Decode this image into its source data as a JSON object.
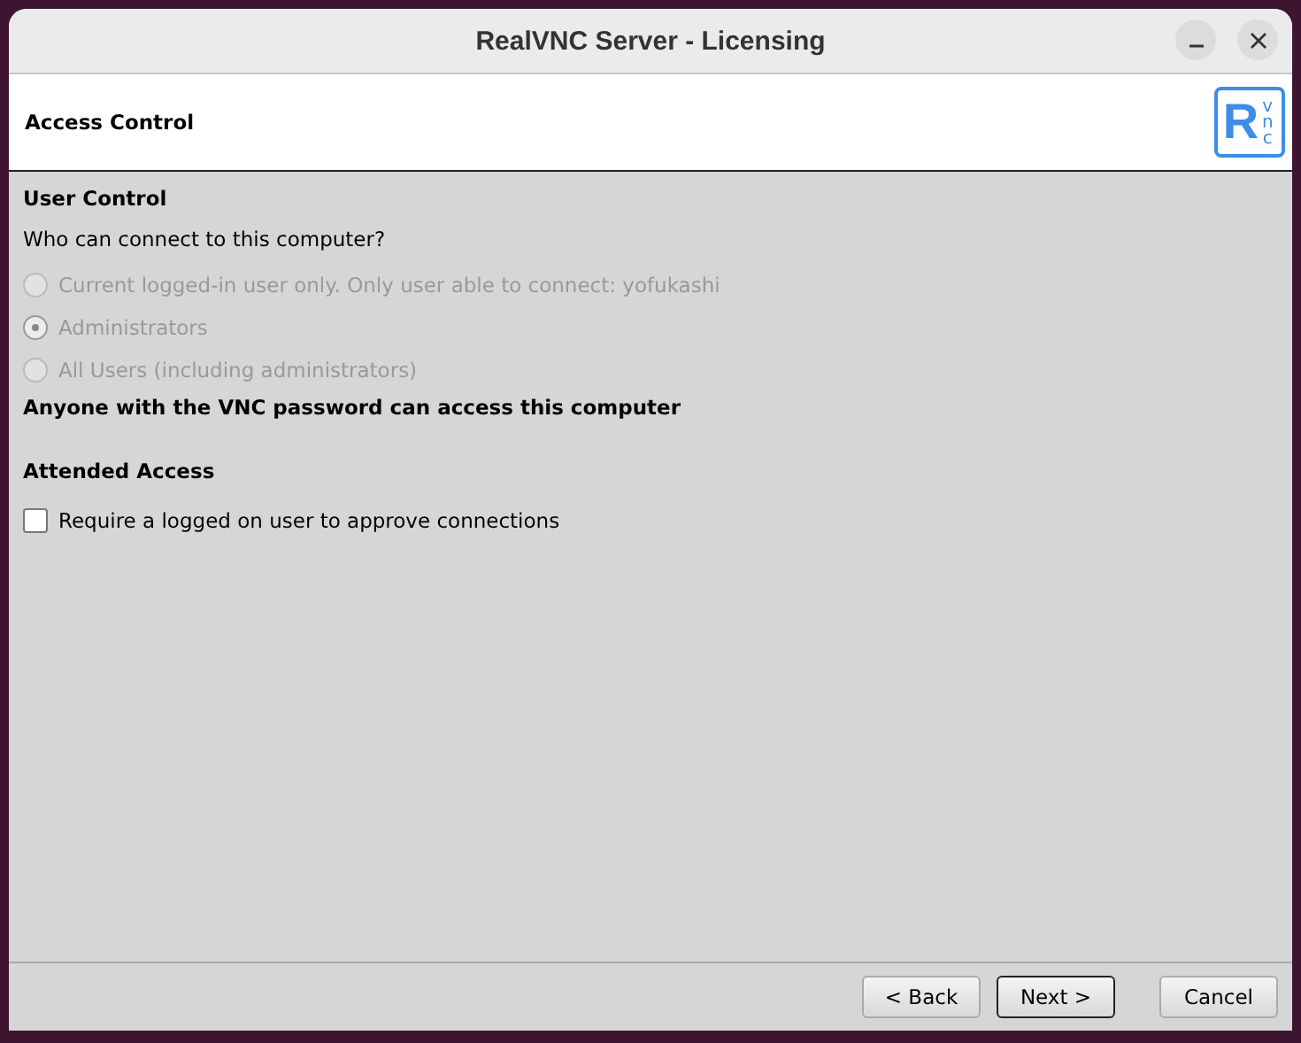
{
  "window": {
    "title": "RealVNC Server - Licensing",
    "controls": [
      {
        "kind": "minimize"
      },
      {
        "kind": "close"
      }
    ]
  },
  "header": {
    "title": "Access Control",
    "logo": {
      "main": "R",
      "side": "vnc"
    }
  },
  "user_control": {
    "heading": "User Control",
    "question": "Who can connect to this computer?",
    "options": [
      {
        "label": "Current logged-in user only. Only user able to connect: yofukashi",
        "selected": false,
        "disabled": true
      },
      {
        "label": "Administrators",
        "selected": true,
        "disabled": true
      },
      {
        "label": "All Users (including administrators)",
        "selected": false,
        "disabled": true
      }
    ],
    "note": "Anyone with the VNC password can access this computer"
  },
  "attended_access": {
    "heading": "Attended Access",
    "checkbox": {
      "label": "Require a logged on user to approve connections",
      "checked": false
    }
  },
  "buttons": [
    {
      "label": "< Back",
      "default": false
    },
    {
      "label": "Next >",
      "default": true
    },
    {
      "label": "Cancel",
      "default": false
    }
  ]
}
